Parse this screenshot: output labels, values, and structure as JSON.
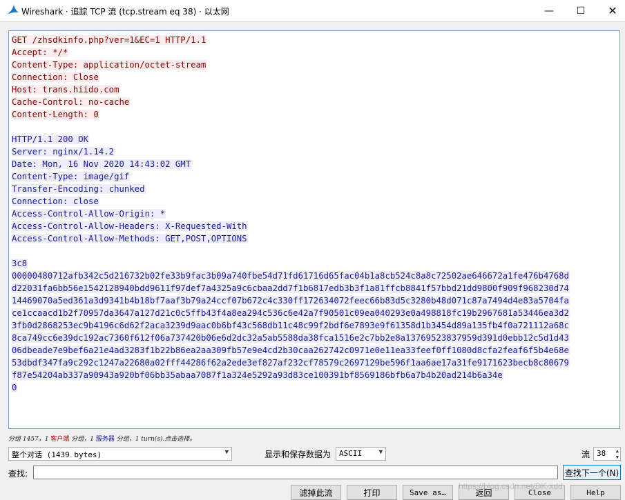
{
  "window": {
    "title": "Wireshark · 追踪 TCP 流 (tcp.stream eq 38) · 以太网",
    "minimize": "—",
    "maximize": "☐",
    "close": "✕",
    "colors": {
      "client_text": "#8b0000",
      "client_bg": "#fbeded",
      "server_text": "#1a1aa0",
      "server_bg": "#ededfb"
    }
  },
  "stream": {
    "request": [
      "GET /zhsdkinfo.php?ver=1&EC=1 HTTP/1.1",
      "Accept: */*",
      "Content-Type: application/octet-stream",
      "Connection: Close",
      "Host: trans.hiido.com",
      "Cache-Control: no-cache",
      "Content-Length: 0"
    ],
    "response_headers": [
      "HTTP/1.1 200 OK",
      "Server: nginx/1.14.2",
      "Date: Mon, 16 Nov 2020 14:43:02 GMT",
      "Content-Type: image/gif",
      "Transfer-Encoding: chunked",
      "Connection: close",
      "Access-Control-Allow-Origin: *",
      "Access-Control-Allow-Headers: X-Requested-With",
      "Access-Control-Allow-Methods: GET,POST,OPTIONS"
    ],
    "response_body": [
      "3c8",
      "00000480712afb342c5d216732b02fe33b9fac3b09a740fbe54d71fd61716d65fac04b1a8cb524c8a8c72502ae646672a1fe476b4768d",
      "d22031fa6bb56e1542128940bdd9611f97def7a4325a9c6cbaa2dd7f1b6817edb3b3f1a81ffcb8841f57bbd21dd9800f909f968230d74",
      "14469070a5ed361a3d9341b4b18bf7aaf3b79a24ccf07b672c4c330ff172634072feec66b83d5c3280b48d071c87a7494d4e83a5704fa",
      "ce1ccaacd1b2f70957da3647a127d21c0c5ffb43f4a8ea294c536c6e42a7f90501c09ea040293e0a498818fc19b2967681a53446ea3d2",
      "3fb0d2868253ec9b4196c6d62f2aca3239d9aac0b6bf43c568db11c48c99f2bdf6e7893e9f61358d1b3454d89a135fb4f0a721112a68c",
      "8ca749cc6e39dc192ac7360f612f06a737420b06e6d2dc32a5ab5588da38fca1516e2c7bb2e8a13769523837959d391d0ebb12c5d1d43",
      "06dbeade7e9bef6a21e4ad3283f1b22b86ea2aa309fb57e9e4cd2b30caa262742c0971e0e11ea33feef0ff1080d8cfa2feaf6f5b4e68e",
      "53dbdf347fa9c292c1247a22680a02fff44286f62a2ede3ef827af232cf78579c2697129be596f1aa6ae17a31fe9171623becb8c80679",
      "f87e54204ab337a90943a920bf06bb35abaa7087f1a324e5292a93d83ce100391bf8569186bfb6a7b4b20ad214b6a34e",
      "0"
    ]
  },
  "status": {
    "prefix": "分组 1457。1 ",
    "client": "客户端",
    "mid": " 分组，1 ",
    "server": "服务器",
    "suffix": " 分组，1 turn(s).点击选择。"
  },
  "controls": {
    "conversation_select": "整个对话 (1439 bytes)",
    "save_format_label": "显示和保存数据为",
    "save_format_select": "ASCII",
    "stream_label": "流",
    "stream_value": "38",
    "find_label": "查找:",
    "find_input_value": "",
    "find_next": "查找下一个(N)"
  },
  "buttons": {
    "filter_out": "滤掉此流",
    "print": "打印",
    "save_as": "Save as…",
    "back": "返回",
    "close": "Close",
    "help": "Help"
  },
  "watermark": "https://blog.csdn.net/DK-xdd"
}
